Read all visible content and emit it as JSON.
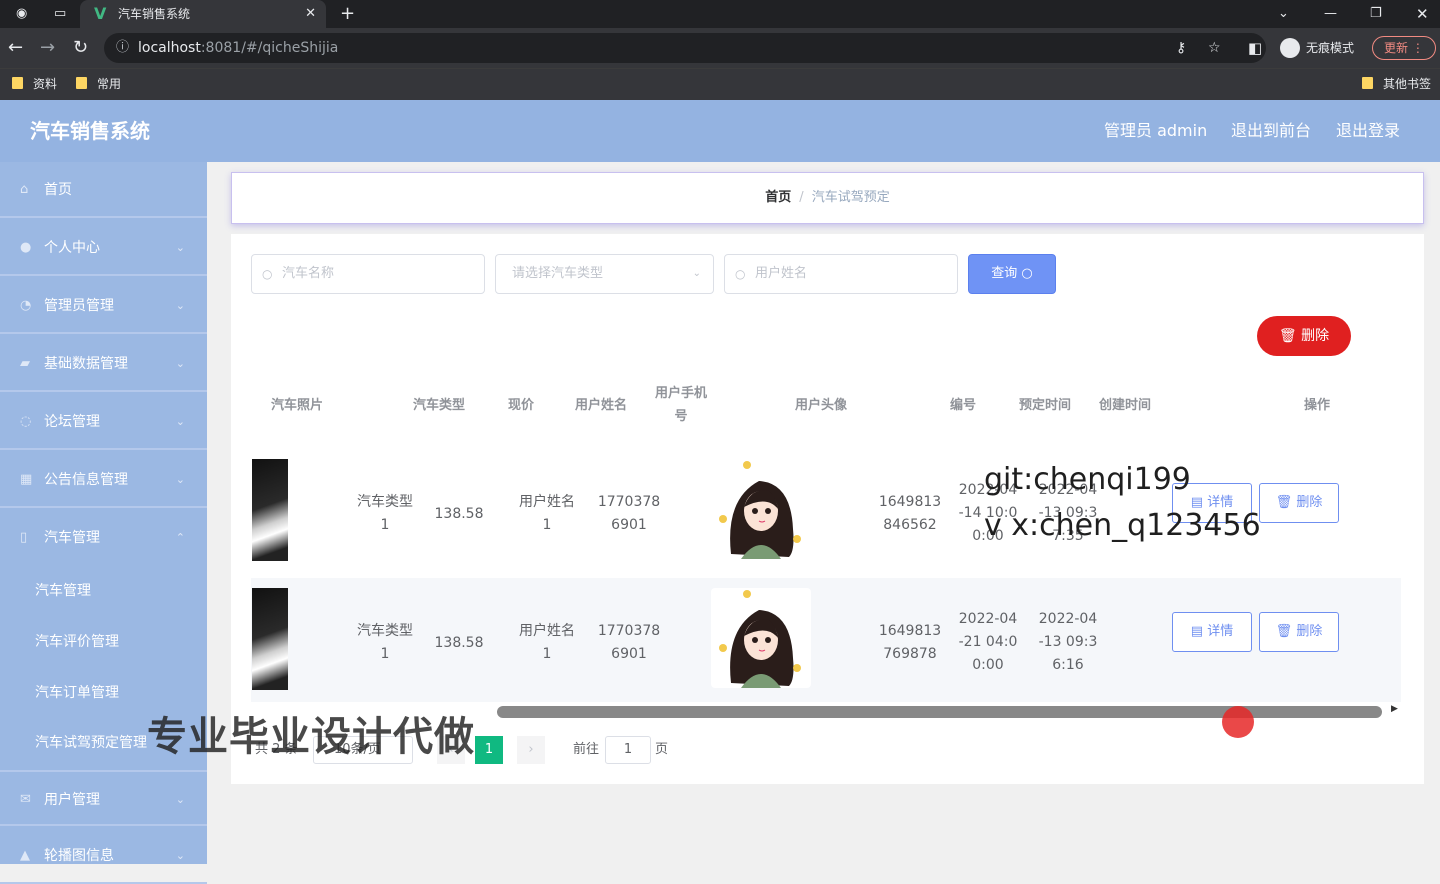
{
  "browser": {
    "tab_title": "汽车销售系统",
    "url_host": "localhost",
    "url_path": ":8081/#/qicheShijia",
    "incognito": "无痕模式",
    "update": "更新",
    "bookmarks": [
      "资料",
      "常用"
    ],
    "other_bookmarks": "其他书签"
  },
  "header": {
    "title": "汽车销售系统",
    "admin": "管理员 admin",
    "to_front": "退出到前台",
    "logout": "退出登录"
  },
  "sidebar": {
    "items": [
      {
        "label": "首页",
        "icon": "home-icon"
      },
      {
        "label": "个人中心",
        "icon": "user-icon"
      },
      {
        "label": "管理员管理",
        "icon": "admin-icon"
      },
      {
        "label": "基础数据管理",
        "icon": "data-icon"
      },
      {
        "label": "论坛管理",
        "icon": "forum-icon"
      },
      {
        "label": "公告信息管理",
        "icon": "notice-icon"
      },
      {
        "label": "汽车管理",
        "icon": "car-icon"
      }
    ],
    "sub_items": [
      "汽车管理",
      "汽车评价管理",
      "汽车订单管理",
      "汽车试驾预定管理"
    ],
    "after_items": [
      {
        "label": "用户管理",
        "icon": "users-icon"
      },
      {
        "label": "轮播图信息",
        "icon": "image-icon"
      }
    ]
  },
  "breadcrumb": {
    "home": "首页",
    "current": "汽车试驾预定"
  },
  "search": {
    "car_name_placeholder": "汽车名称",
    "car_type_placeholder": "请选择汽车类型",
    "user_name_placeholder": "用户姓名",
    "query_label": "查询",
    "delete_label": "删除"
  },
  "table": {
    "headers": {
      "photo": "汽车照片",
      "type": "汽车类型",
      "price": "现价",
      "user_name": "用户姓名",
      "phone_1": "用户手机",
      "phone_2": "号",
      "avatar": "用户头像",
      "number": "编号",
      "reserve_time": "预定时间",
      "create_time": "创建时间",
      "ops": "操作"
    },
    "rows": [
      {
        "type_1": "汽车类型",
        "type_2": "1",
        "price": "138.58",
        "user_1": "用户姓名",
        "user_2": "1",
        "phone_1": "1770378",
        "phone_2": "6901",
        "number_1": "1649813",
        "number_2": "846562",
        "reserve_1": "2022-04",
        "reserve_2": "-14 10:0",
        "reserve_3": "0:00",
        "create_1": "2022-04",
        "create_2": "-13 09:3",
        "create_3": "7:35",
        "detail": "详情",
        "delete": "删除"
      },
      {
        "type_1": "汽车类型",
        "type_2": "1",
        "price": "138.58",
        "user_1": "用户姓名",
        "user_2": "1",
        "phone_1": "1770378",
        "phone_2": "6901",
        "number_1": "1649813",
        "number_2": "769878",
        "reserve_1": "2022-04",
        "reserve_2": "-21 04:0",
        "reserve_3": "0:00",
        "create_1": "2022-04",
        "create_2": "-13 09:3",
        "create_3": "6:16",
        "detail": "详情",
        "delete": "删除"
      }
    ]
  },
  "pagination": {
    "total": "共 2 条",
    "page_size": "10条/页",
    "current_page": "1",
    "goto_label": "前往",
    "goto_value": "1",
    "page_unit": "页"
  },
  "overlay": {
    "git": "git:chenqi199",
    "vx": "v x:chen_q123456",
    "watermark": "专业毕业设计代做"
  }
}
